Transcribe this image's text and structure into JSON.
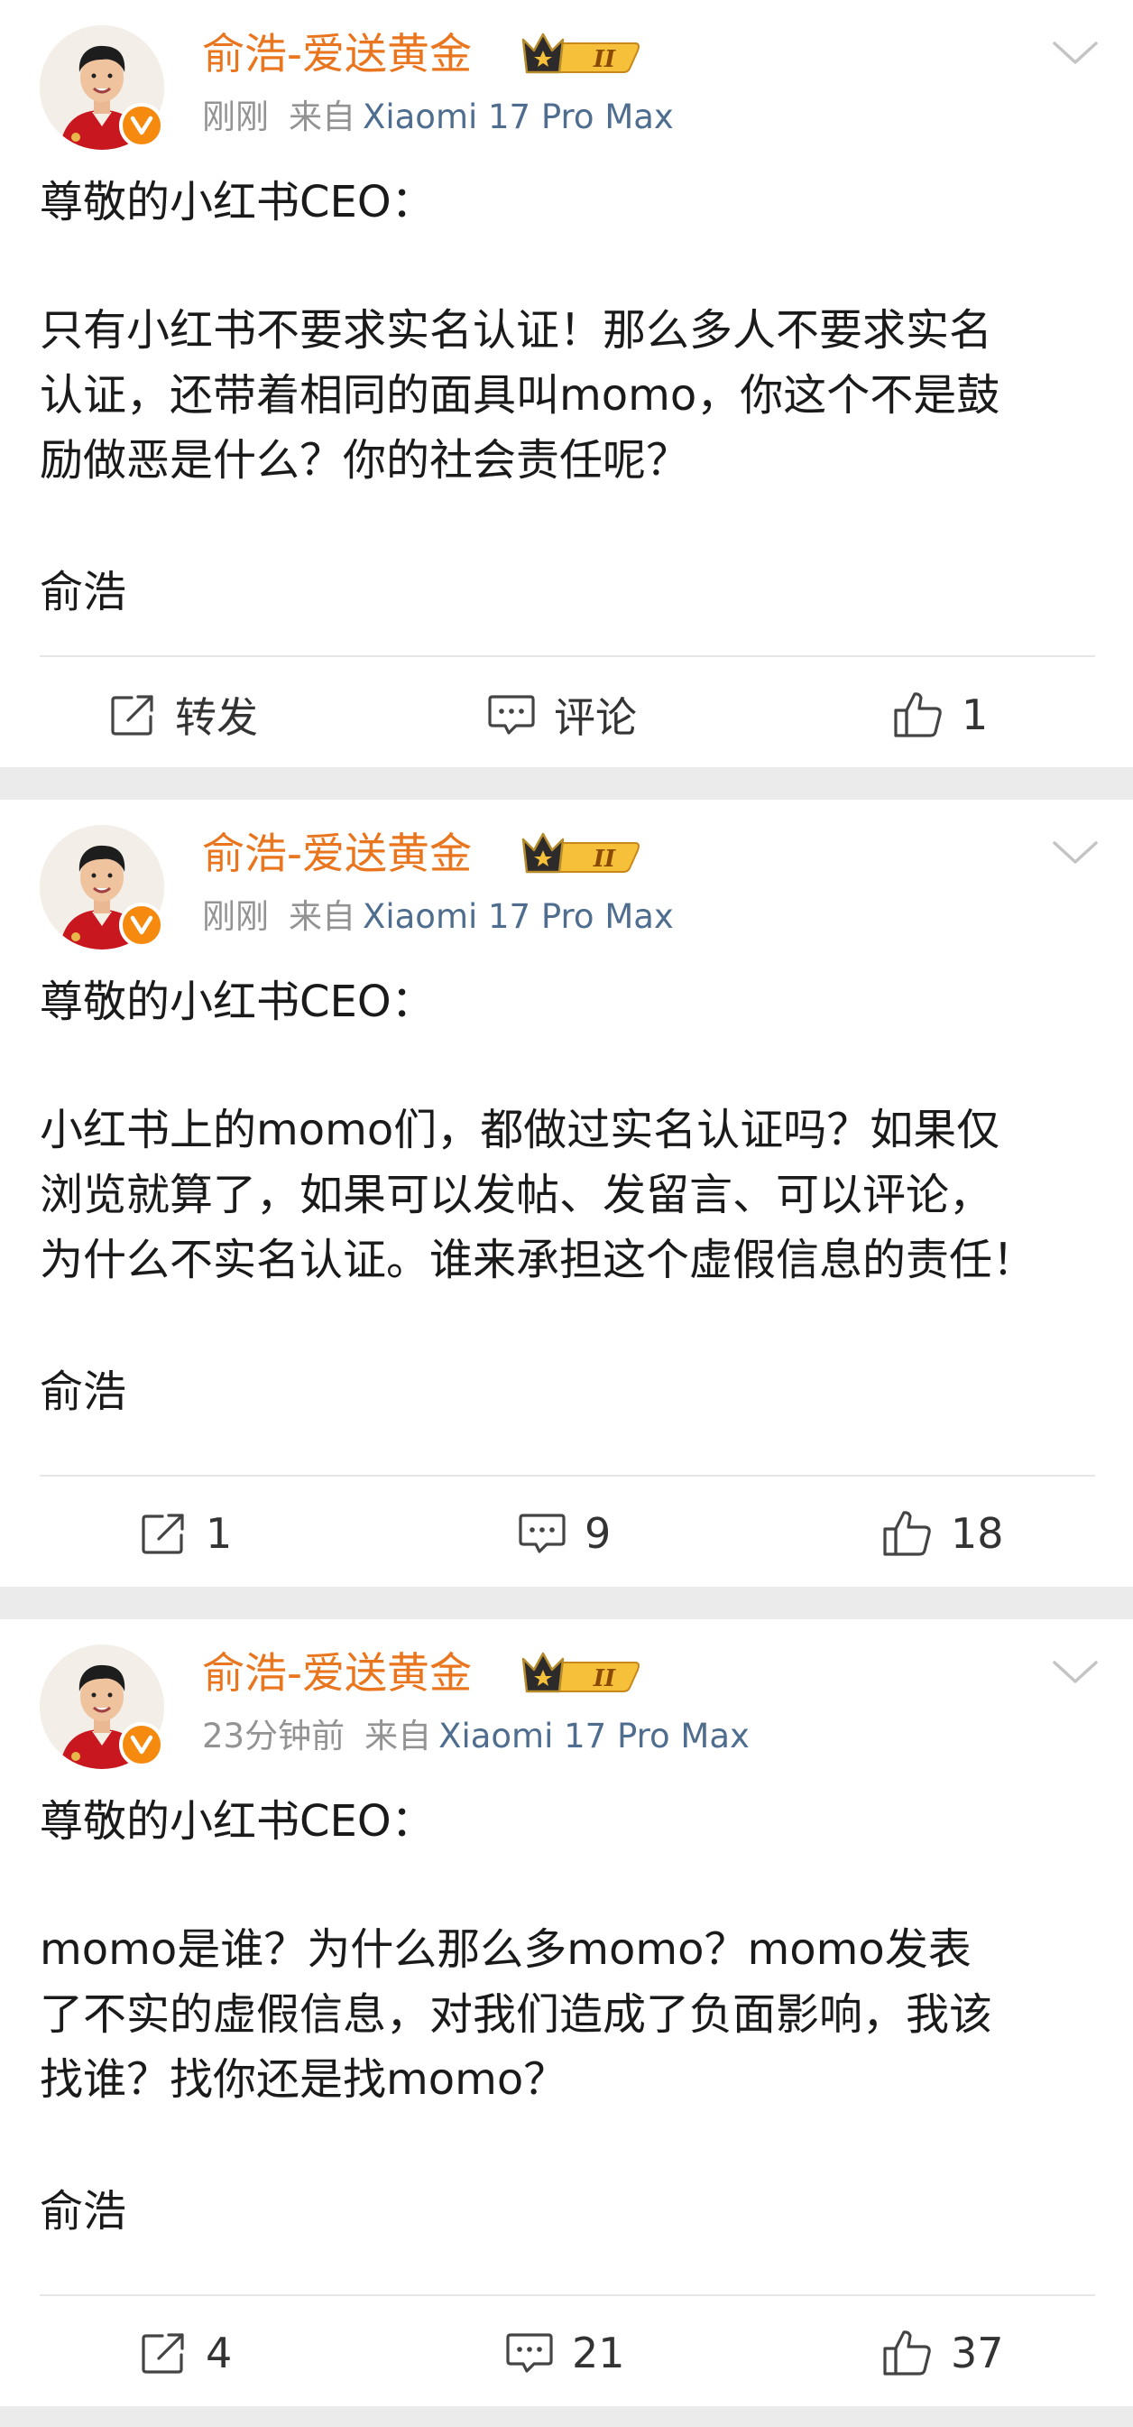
{
  "posts": [
    {
      "author": "俞浩-爱送黄金",
      "level_badge": "II",
      "time": "刚刚",
      "source_prefix": "来自",
      "device": "Xiaomi 17 Pro Max",
      "greeting": "尊敬的小红书CEO：",
      "body_lines": [
        "只有小红书不要求实名认证！那么多人不要求实名",
        "认证，还带着相同的面具叫momo，你这个不是鼓",
        "励做恶是什么？你的社会责任呢？"
      ],
      "signature": "俞浩",
      "actions": {
        "repost": "转发",
        "comment": "评论",
        "like": "1"
      }
    },
    {
      "author": "俞浩-爱送黄金",
      "level_badge": "II",
      "time": "刚刚",
      "source_prefix": "来自",
      "device": "Xiaomi 17 Pro Max",
      "greeting": "尊敬的小红书CEO：",
      "body_lines": [
        "小红书上的momo们，都做过实名认证吗？如果仅",
        "浏览就算了，如果可以发帖、发留言、可以评论，",
        "为什么不实名认证。谁来承担这个虚假信息的责任！"
      ],
      "signature": "俞浩",
      "actions": {
        "repost": "1",
        "comment": "9",
        "like": "18"
      }
    },
    {
      "author": "俞浩-爱送黄金",
      "level_badge": "II",
      "time": "23分钟前",
      "source_prefix": "来自",
      "device": "Xiaomi 17 Pro Max",
      "greeting": "尊敬的小红书CEO：",
      "body_lines": [
        "momo是谁？为什么那么多momo？momo发表",
        "了不实的虚假信息，对我们造成了负面影响，我该",
        "找谁？找你还是找momo？"
      ],
      "signature": "俞浩",
      "actions": {
        "repost": "4",
        "comment": "21",
        "like": "37"
      }
    }
  ],
  "icons": {
    "avatar": "avatar",
    "verified": "verified-v-icon",
    "crown": "crown-level-icon",
    "more": "chevron-down-icon",
    "repost": "repost-icon",
    "comment": "comment-icon",
    "like": "thumbs-up-icon"
  },
  "colors": {
    "author": "#e9751e",
    "device": "#4f6d8f",
    "meta": "#939393",
    "separator": "#ebebeb",
    "verified": "#f58a0e"
  }
}
